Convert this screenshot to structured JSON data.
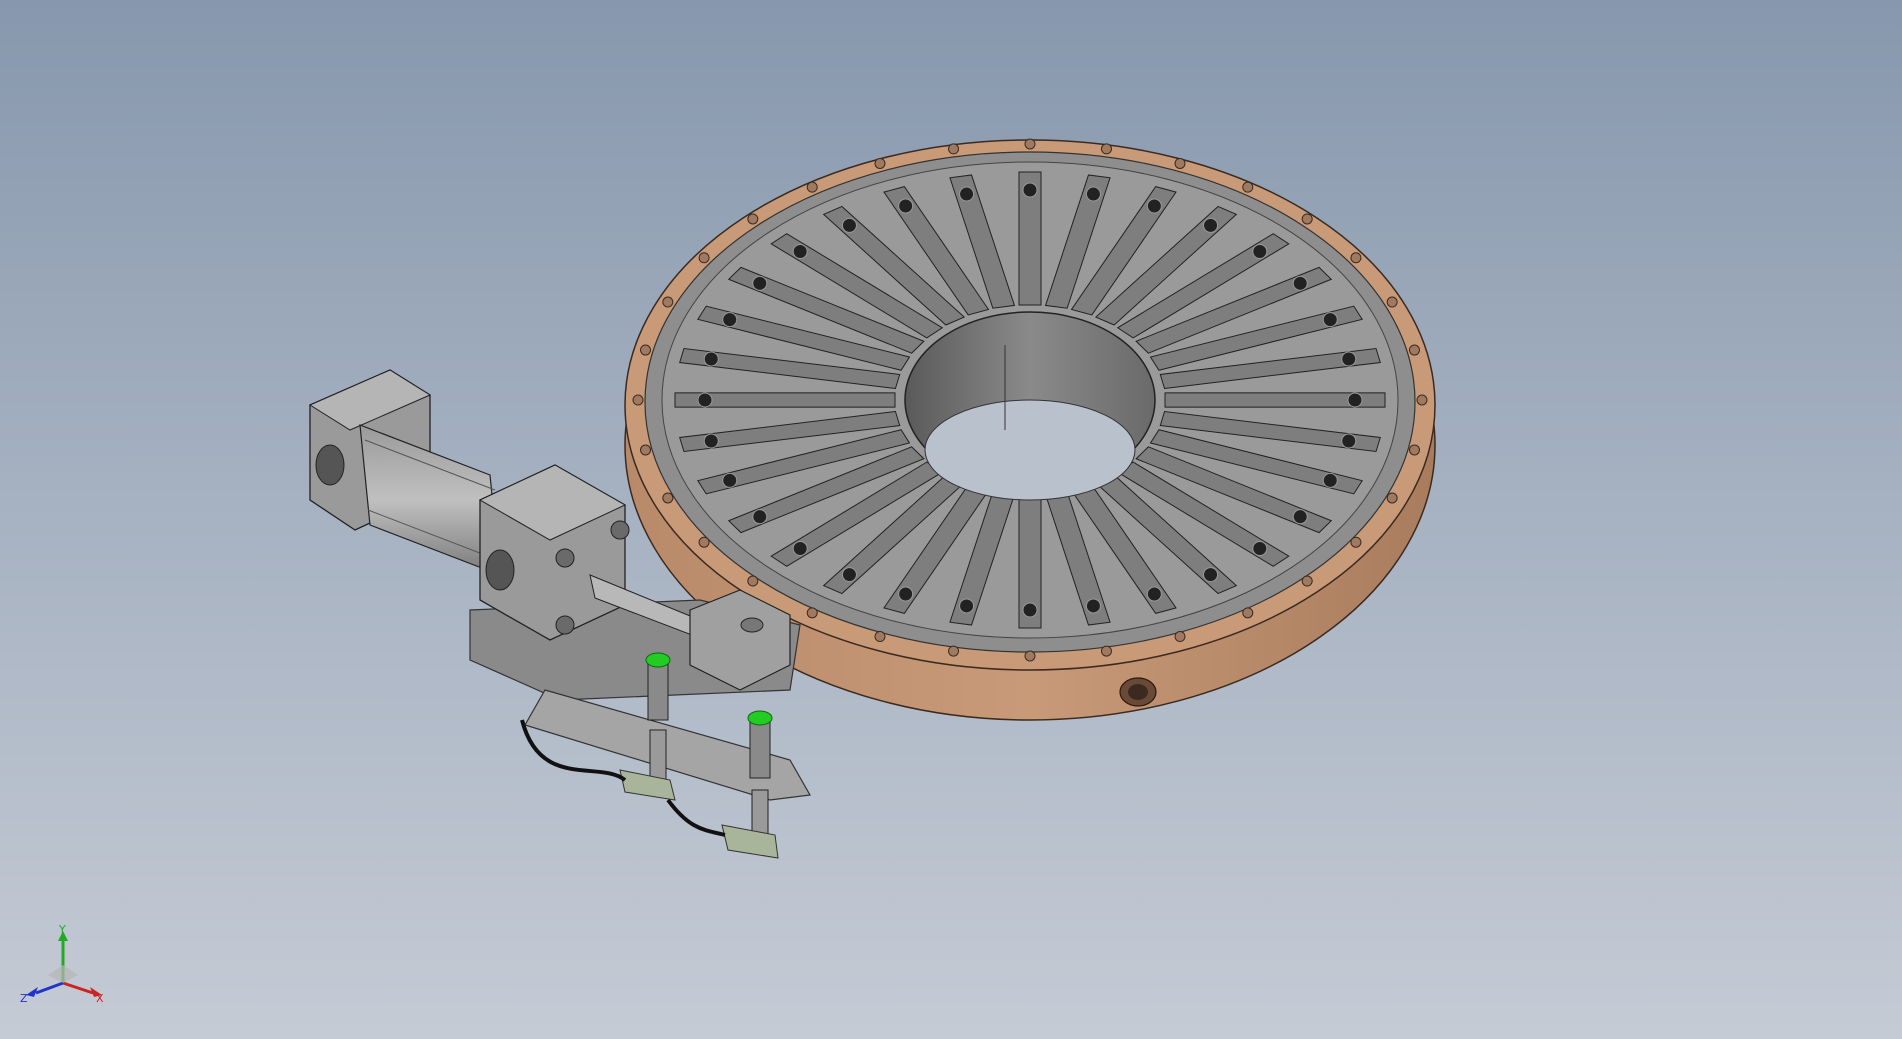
{
  "viewport": {
    "background_top": "#8797ad",
    "background_bottom": "#c5cbd5"
  },
  "model": {
    "ring_color": "#c89a78",
    "plate_color": "#8c8c8c",
    "finger_count": 32,
    "sensor_cap_color": "#22cc22"
  },
  "triad": {
    "x_label": "X",
    "y_label": "Y",
    "z_label": "Z",
    "x_color": "#cc2222",
    "y_color": "#22aa22",
    "z_color": "#2233cc"
  }
}
